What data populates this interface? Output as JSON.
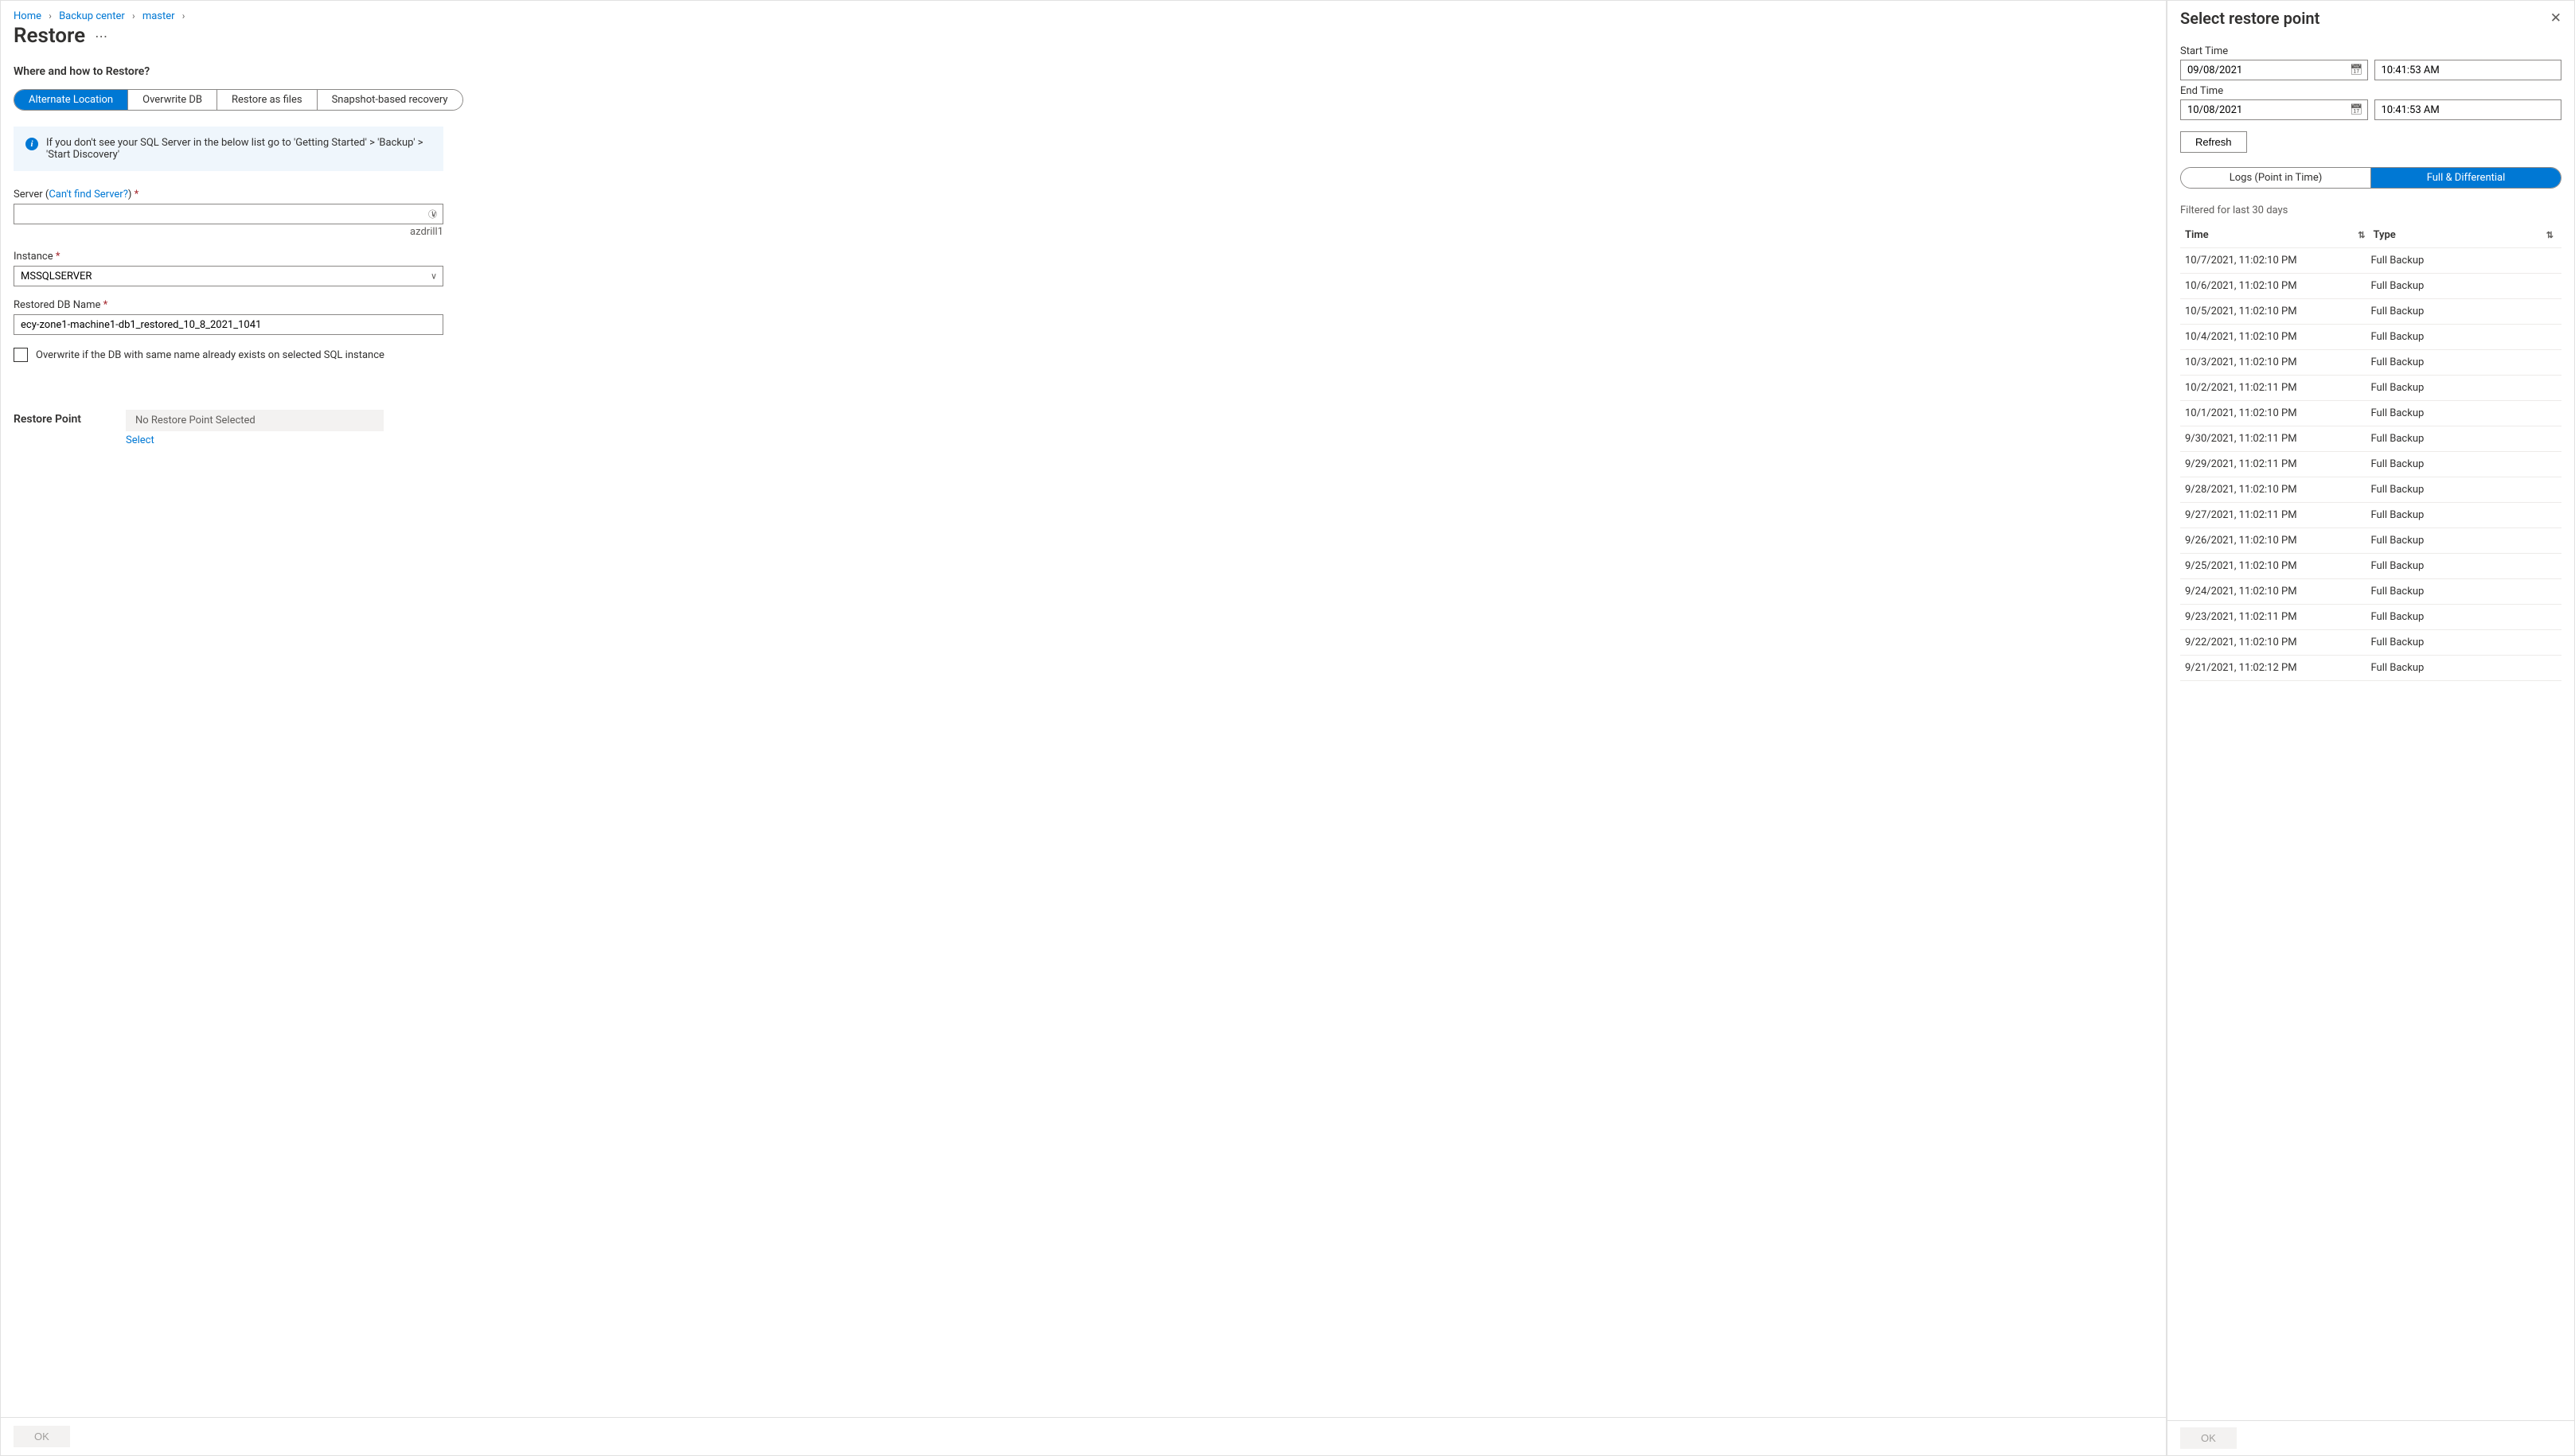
{
  "breadcrumb": {
    "home": "Home",
    "backup_center": "Backup center",
    "master": "master"
  },
  "page": {
    "title": "Restore",
    "ok": "OK"
  },
  "section": {
    "heading": "Where and how to Restore?",
    "tabs": {
      "alternate": "Alternate Location",
      "overwrite": "Overwrite DB",
      "files": "Restore as files",
      "snapshot": "Snapshot-based recovery"
    },
    "info": "If you don't see your SQL Server in the below list go to 'Getting Started' > 'Backup' > 'Start Discovery'"
  },
  "fields": {
    "server_label_prefix": "Server (",
    "server_link": "Can't find Server?",
    "server_label_suffix": ")",
    "server_value": "",
    "server_helper": "azdrill1",
    "instance_label": "Instance",
    "instance_value": "MSSQLSERVER",
    "dbname_label": "Restored DB Name",
    "dbname_value": "ecy-zone1-machine1-db1_restored_10_8_2021_1041",
    "overwrite_chk": "Overwrite if the DB with same name already exists on selected SQL instance"
  },
  "restore_point": {
    "label": "Restore Point",
    "status": "No Restore Point Selected",
    "select": "Select"
  },
  "panel": {
    "title": "Select restore point",
    "start_label": "Start Time",
    "start_date": "09/08/2021",
    "start_time": "10:41:53 AM",
    "end_label": "End Time",
    "end_date": "10/08/2021",
    "end_time": "10:41:53 AM",
    "refresh": "Refresh",
    "tabs": {
      "logs": "Logs (Point in Time)",
      "full": "Full & Differential"
    },
    "filter_note": "Filtered for last 30 days",
    "col_time": "Time",
    "col_type": "Type",
    "rows": [
      {
        "time": "10/7/2021, 11:02:10 PM",
        "type": "Full Backup"
      },
      {
        "time": "10/6/2021, 11:02:10 PM",
        "type": "Full Backup"
      },
      {
        "time": "10/5/2021, 11:02:10 PM",
        "type": "Full Backup"
      },
      {
        "time": "10/4/2021, 11:02:10 PM",
        "type": "Full Backup"
      },
      {
        "time": "10/3/2021, 11:02:10 PM",
        "type": "Full Backup"
      },
      {
        "time": "10/2/2021, 11:02:11 PM",
        "type": "Full Backup"
      },
      {
        "time": "10/1/2021, 11:02:10 PM",
        "type": "Full Backup"
      },
      {
        "time": "9/30/2021, 11:02:11 PM",
        "type": "Full Backup"
      },
      {
        "time": "9/29/2021, 11:02:11 PM",
        "type": "Full Backup"
      },
      {
        "time": "9/28/2021, 11:02:10 PM",
        "type": "Full Backup"
      },
      {
        "time": "9/27/2021, 11:02:11 PM",
        "type": "Full Backup"
      },
      {
        "time": "9/26/2021, 11:02:10 PM",
        "type": "Full Backup"
      },
      {
        "time": "9/25/2021, 11:02:10 PM",
        "type": "Full Backup"
      },
      {
        "time": "9/24/2021, 11:02:10 PM",
        "type": "Full Backup"
      },
      {
        "time": "9/23/2021, 11:02:11 PM",
        "type": "Full Backup"
      },
      {
        "time": "9/22/2021, 11:02:10 PM",
        "type": "Full Backup"
      },
      {
        "time": "9/21/2021, 11:02:12 PM",
        "type": "Full Backup"
      }
    ],
    "ok": "OK"
  }
}
